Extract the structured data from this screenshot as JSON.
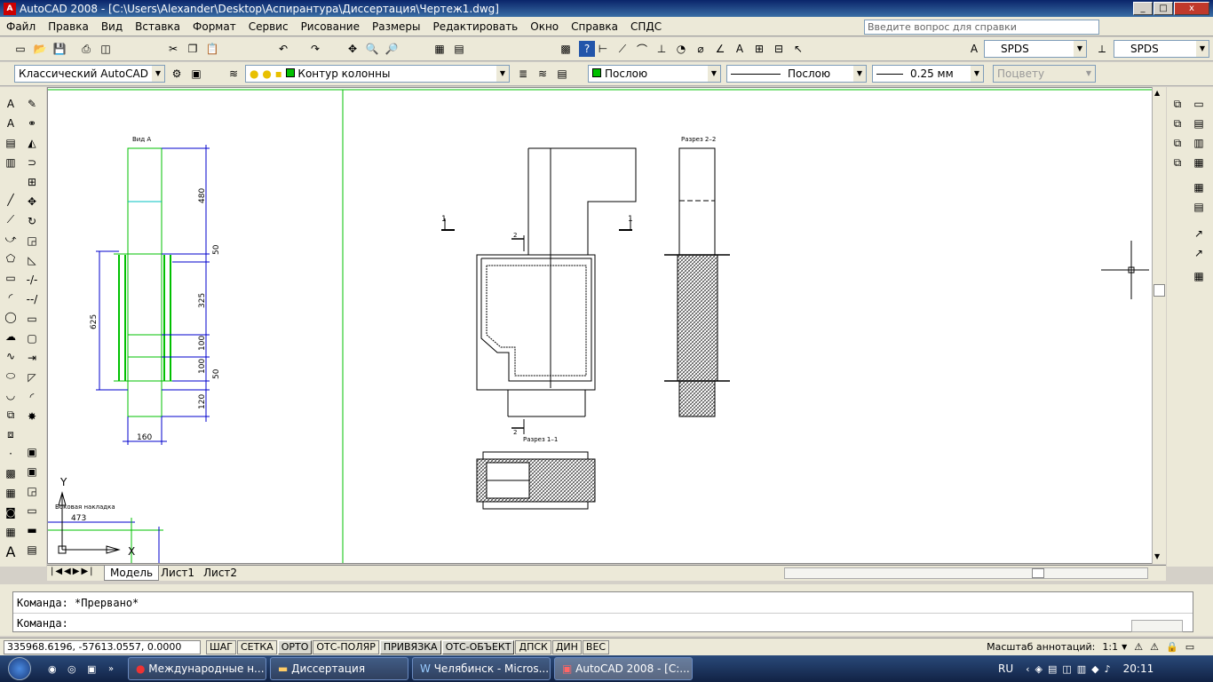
{
  "window": {
    "title": "AutoCAD 2008 - [C:\\Users\\Alexander\\Desktop\\Аспирантура\\Диссертация\\Чертеж1.dwg]"
  },
  "menu": [
    "Файл",
    "Правка",
    "Вид",
    "Вставка",
    "Формат",
    "Сервис",
    "Рисование",
    "Размеры",
    "Редактировать",
    "Окно",
    "Справка",
    "СПДС"
  ],
  "help_placeholder": "Введите вопрос для справки",
  "toolbar": {
    "text_style": "SPDS",
    "dim_style": "SPDS",
    "workspace": "Классический AutoCAD",
    "layer": "Контур колонны",
    "color": "Послою",
    "linetype": "Послою",
    "lineweight": "0.25 мм",
    "plotstyle": "Поцвету"
  },
  "drawing": {
    "view_a_label": "Вид А",
    "section22_label": "Разрез 2–2",
    "section11_label": "Разрез 1–1",
    "side_label": "Боковая накладка",
    "dims": {
      "d480": "480",
      "d50a": "50",
      "d325": "325",
      "d100a": "100",
      "d100b": "100",
      "d50b": "50",
      "d120": "120",
      "d625": "625",
      "d160": "160",
      "d473": "473"
    },
    "marks": {
      "m1a": "1",
      "m1b": "1",
      "m2a": "2",
      "m2b": "2"
    },
    "ucs": {
      "x": "X",
      "y": "Y"
    }
  },
  "tabs": [
    "Модель",
    "Лист1",
    "Лист2"
  ],
  "command": {
    "line1": "Команда: *Прервано*",
    "line2": "Команда:"
  },
  "status": {
    "coords": "335968.6196, -57613.0557, 0.0000",
    "buttons": [
      "ШАГ",
      "СЕТКА",
      "ОРТО",
      "ОТС-ПОЛЯР",
      "ПРИВЯЗКА",
      "ОТС-ОБЪЕКТ",
      "ДПСК",
      "ДИН",
      "ВЕС"
    ],
    "anno_label": "Масштаб аннотаций:",
    "anno_value": "1:1"
  },
  "taskbar": {
    "tasks": [
      "Международные н...",
      "Диссертация",
      "Челябинск - Micros...",
      "AutoCAD 2008 - [C:..."
    ],
    "lang": "RU",
    "clock": "20:11"
  },
  "colors": {
    "accent": "#0a246a",
    "green_line": "#00c000",
    "dim_blue": "#0000cc"
  }
}
